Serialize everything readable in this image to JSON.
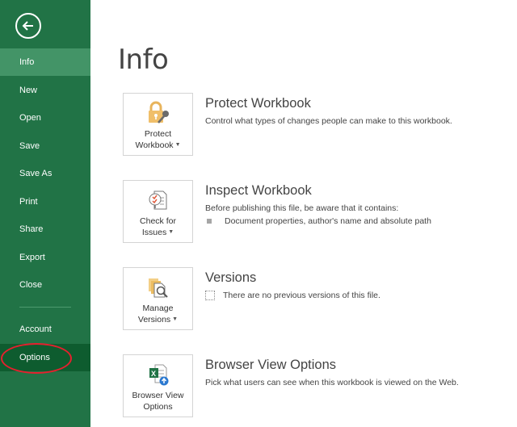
{
  "sidebar": {
    "back_icon": "back-arrow-circle-icon",
    "items": [
      {
        "label": "Info",
        "state": "selected"
      },
      {
        "label": "New"
      },
      {
        "label": "Open"
      },
      {
        "label": "Save"
      },
      {
        "label": "Save As"
      },
      {
        "label": "Print"
      },
      {
        "label": "Share"
      },
      {
        "label": "Export"
      },
      {
        "label": "Close"
      },
      {
        "label": "Account"
      },
      {
        "label": "Options",
        "state": "highlighted",
        "annotation": "red-circle"
      }
    ]
  },
  "colors": {
    "sidebar_bg": "#217346",
    "selected_bg": "#439467",
    "highlight_bg": "#0e5c2f",
    "annotation": "#e5202e"
  },
  "main": {
    "title": "Info",
    "sections": [
      {
        "tile_line1": "Protect",
        "tile_line2": "Workbook",
        "tile_has_caret": true,
        "icon": "lock-key-icon",
        "title": "Protect Workbook",
        "desc": "Control what types of changes people can make to this workbook."
      },
      {
        "tile_line1": "Check for",
        "tile_line2": "Issues",
        "tile_has_caret": true,
        "icon": "checklist-document-icon",
        "title": "Inspect Workbook",
        "desc": "Before publishing this file, be aware that it contains:",
        "bullets": [
          "Document properties, author's name and absolute path"
        ]
      },
      {
        "tile_line1": "Manage",
        "tile_line2": "Versions",
        "tile_has_caret": true,
        "icon": "manage-versions-icon",
        "title": "Versions",
        "desc": "There are no previous versions of this file."
      },
      {
        "tile_line1": "Browser View",
        "tile_line2": "Options",
        "tile_has_caret": false,
        "icon": "excel-browser-view-icon",
        "title": "Browser View Options",
        "desc": "Pick what users can see when this workbook is viewed on the Web."
      }
    ]
  }
}
